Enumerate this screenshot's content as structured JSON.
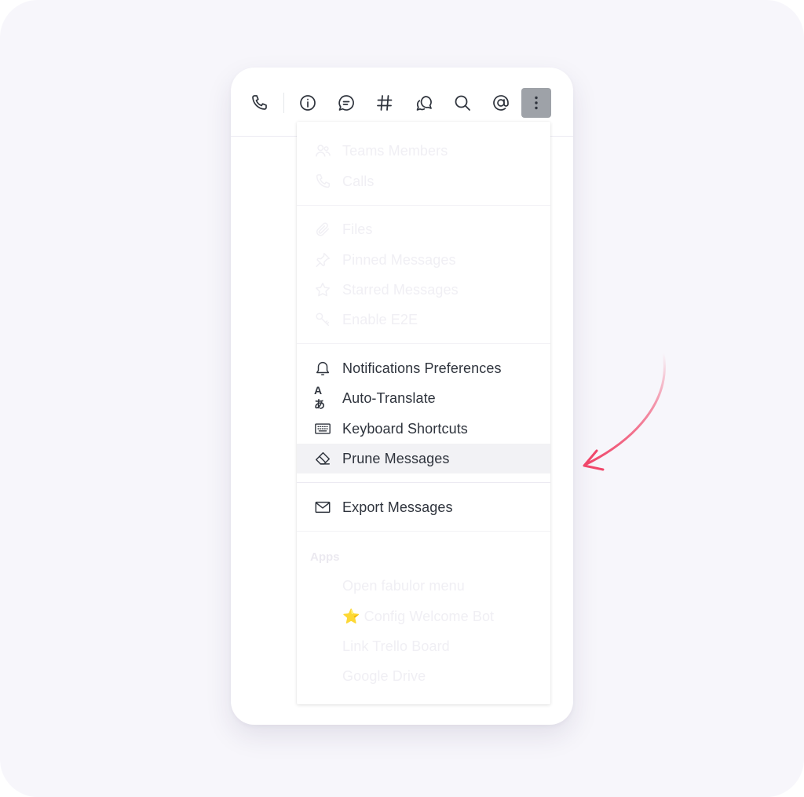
{
  "toolbar": {
    "buttons": [
      {
        "icon": "phone-icon"
      },
      {
        "icon": "info-icon"
      },
      {
        "icon": "discussion-icon"
      },
      {
        "icon": "hash-icon"
      },
      {
        "icon": "threads-icon"
      },
      {
        "icon": "search-icon"
      },
      {
        "icon": "mention-icon"
      },
      {
        "icon": "kebab-menu-icon",
        "active": true
      }
    ]
  },
  "menu": {
    "group1": [
      {
        "label": "Teams Members",
        "icon": "team-icon"
      },
      {
        "label": "Calls",
        "icon": "phone-icon"
      }
    ],
    "group2": [
      {
        "label": "Files",
        "icon": "clip-icon"
      },
      {
        "label": "Pinned Messages",
        "icon": "pin-icon"
      },
      {
        "label": "Starred Messages",
        "icon": "star-icon"
      },
      {
        "label": "Enable E2E",
        "icon": "key-icon"
      }
    ],
    "group3": [
      {
        "label": "Notifications Preferences",
        "icon": "bell-icon"
      },
      {
        "label": "Auto-Translate",
        "icon": "language-icon",
        "glyph": "Aあ"
      },
      {
        "label": "Keyboard Shortcuts",
        "icon": "keyboard-icon"
      },
      {
        "label": "Prune Messages",
        "icon": "eraser-icon",
        "highlighted": true
      }
    ],
    "group4": [
      {
        "label": "Export Messages",
        "icon": "mail-icon"
      }
    ],
    "apps_label": "Apps",
    "apps": [
      {
        "label": "Open fabulor menu"
      },
      {
        "label": "⭐ Config Welcome Bot"
      },
      {
        "label": "Link Trello Board"
      },
      {
        "label": "Google Drive"
      }
    ]
  },
  "colors": {
    "accent_arrow": "#f0476a",
    "active_button": "#9ea2a8",
    "text_primary": "#2f343d",
    "text_faded": "#f0eff4",
    "highlight_row": "#f2f2f5"
  }
}
